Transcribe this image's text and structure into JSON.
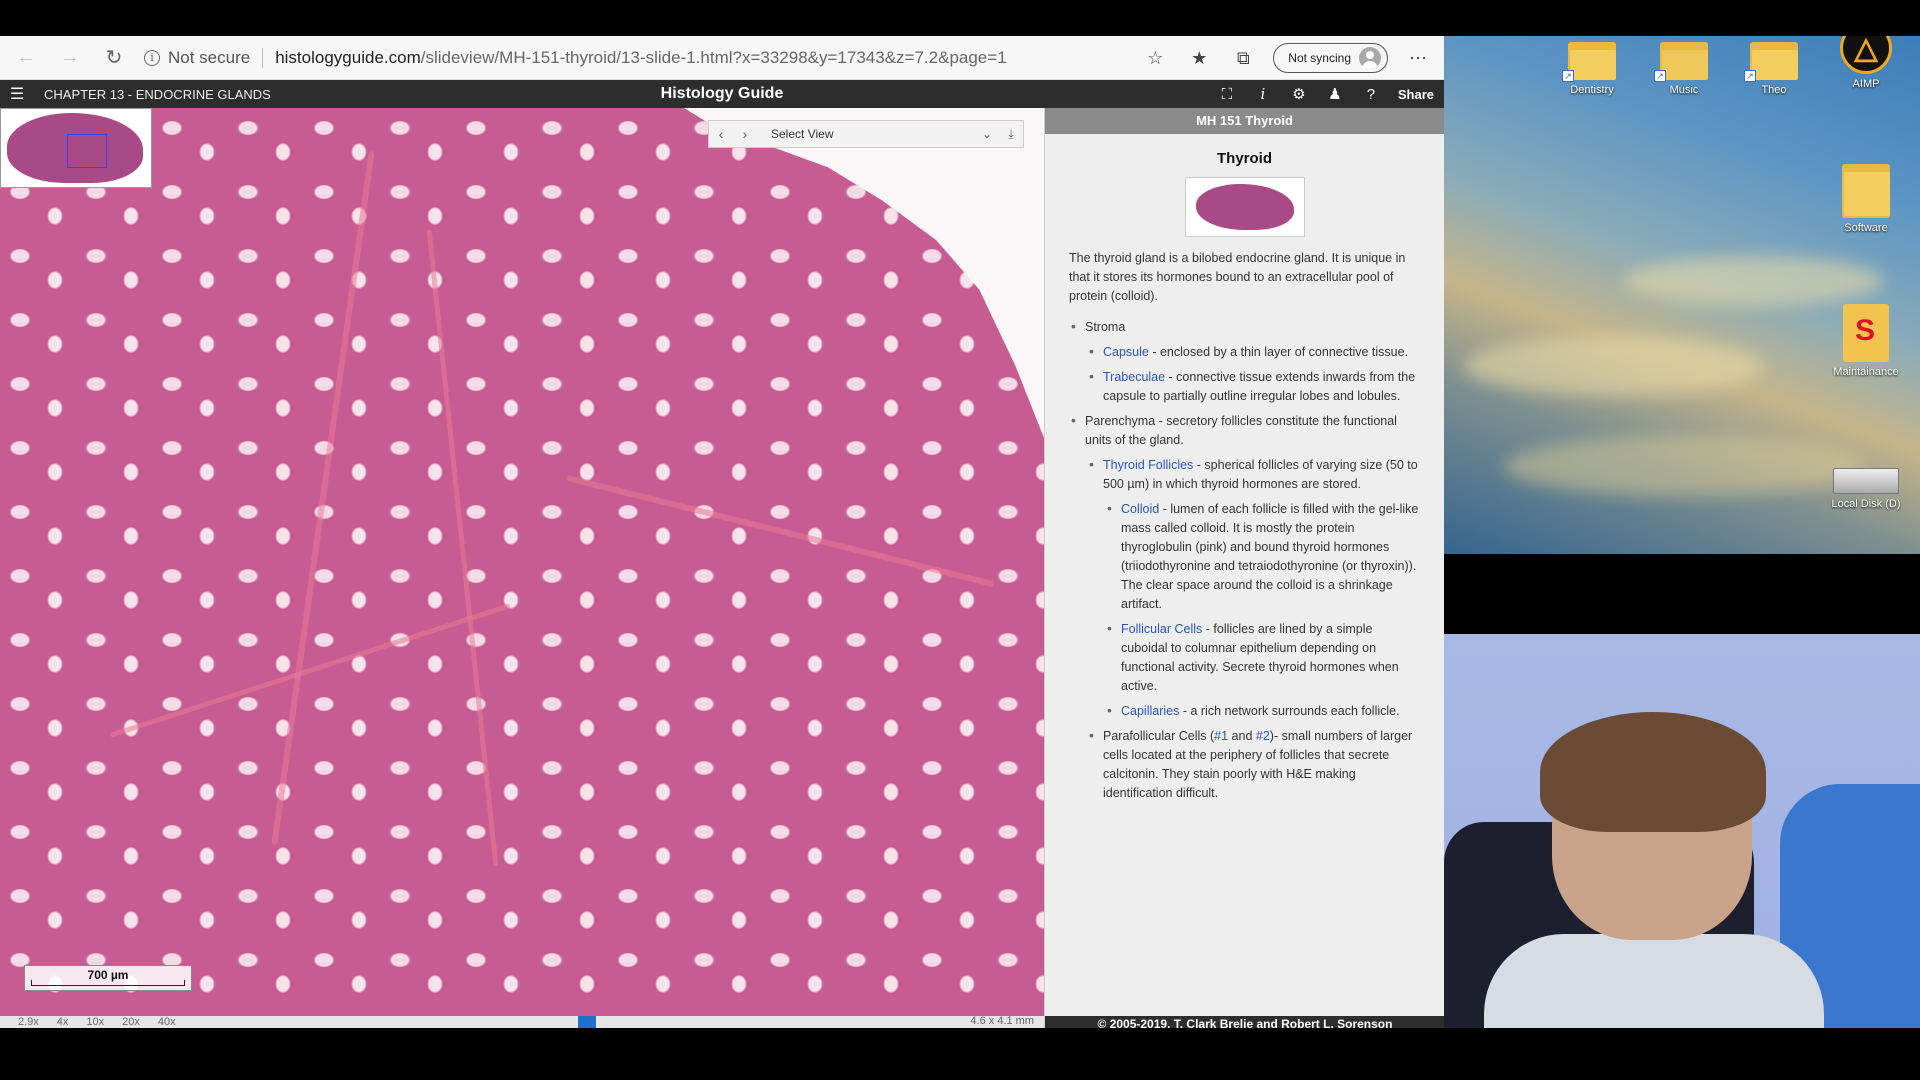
{
  "browser": {
    "security_label": "Not secure",
    "url_host": "histologyguide.com",
    "url_path": "/slideview/MH-151-thyroid/13-slide-1.html?x=33298&y=17343&z=7.2&page=1",
    "sync_label": "Not syncing",
    "icons": [
      "back-arrow-icon",
      "forward-arrow-icon",
      "refresh-icon",
      "info-icon",
      "star-icon",
      "favorites-icon",
      "collections-icon",
      "more-icon"
    ]
  },
  "site": {
    "chapter": "CHAPTER 13 - ENDOCRINE GLANDS",
    "title": "Histology Guide",
    "share": "Share"
  },
  "viewer": {
    "select_view": "Select View",
    "scale_label": "700 µm",
    "zoom_current": "2.9x",
    "zoom_levels": [
      "4x",
      "10x",
      "20x",
      "40x"
    ],
    "dimensions": "4.6 x 4.1 mm"
  },
  "panel": {
    "header": "MH 151 Thyroid",
    "title": "Thyroid",
    "intro": "The thyroid gland is a bilobed endocrine gland. It is unique in that it stores its hormones bound to an extracellular pool of protein (colloid).",
    "stroma": "Stroma",
    "capsule_link": "Capsule",
    "capsule_text": " - enclosed by a thin layer of connective tissue.",
    "trabeculae_link": "Trabeculae",
    "trabeculae_text": " - connective tissue extends inwards from the capsule to partially outline irregular lobes and lobules.",
    "parenchyma": "Parenchyma - secretory follicles constitute the functional units of the gland.",
    "follicles_link": "Thyroid Follicles",
    "follicles_text": " - spherical follicles of varying size (50 to 500 µm) in which thyroid hormones are stored.",
    "colloid_link": "Colloid",
    "colloid_text": " - lumen of each follicle is filled with the gel-like mass called colloid. It is mostly the protein thyroglobulin (pink) and bound thyroid hormones (triiodothyronine and tetraiodothyronine (or thyroxin)). The clear space around the colloid is a shrinkage artifact.",
    "follicular_link": "Follicular Cells",
    "follicular_text": " - follicles are lined by a simple cuboidal to columnar epithelium depending on functional activity. Secrete thyroid hormones when active.",
    "capillaries_link": "Capillaries",
    "capillaries_text": " - a rich network surrounds each follicle.",
    "parafollicular_pre": "Parafollicular Cells (",
    "para_link1": "#1",
    "para_and": " and ",
    "para_link2": "#2",
    "parafollicular_text": ")- small numbers of larger cells located at the periphery of follicles that secrete calcitonin. They stain poorly with H&E making identification difficult.",
    "footer": "© 2005-2019, T. Clark Brelje and Robert L. Sorenson"
  },
  "desktop": {
    "icons": [
      {
        "label": "Dentistry"
      },
      {
        "label": "Music"
      },
      {
        "label": "Theo"
      },
      {
        "label": "AIMP"
      },
      {
        "label": "Software"
      },
      {
        "label": "Maintainance"
      },
      {
        "label": "Local Disk (D)"
      }
    ]
  }
}
